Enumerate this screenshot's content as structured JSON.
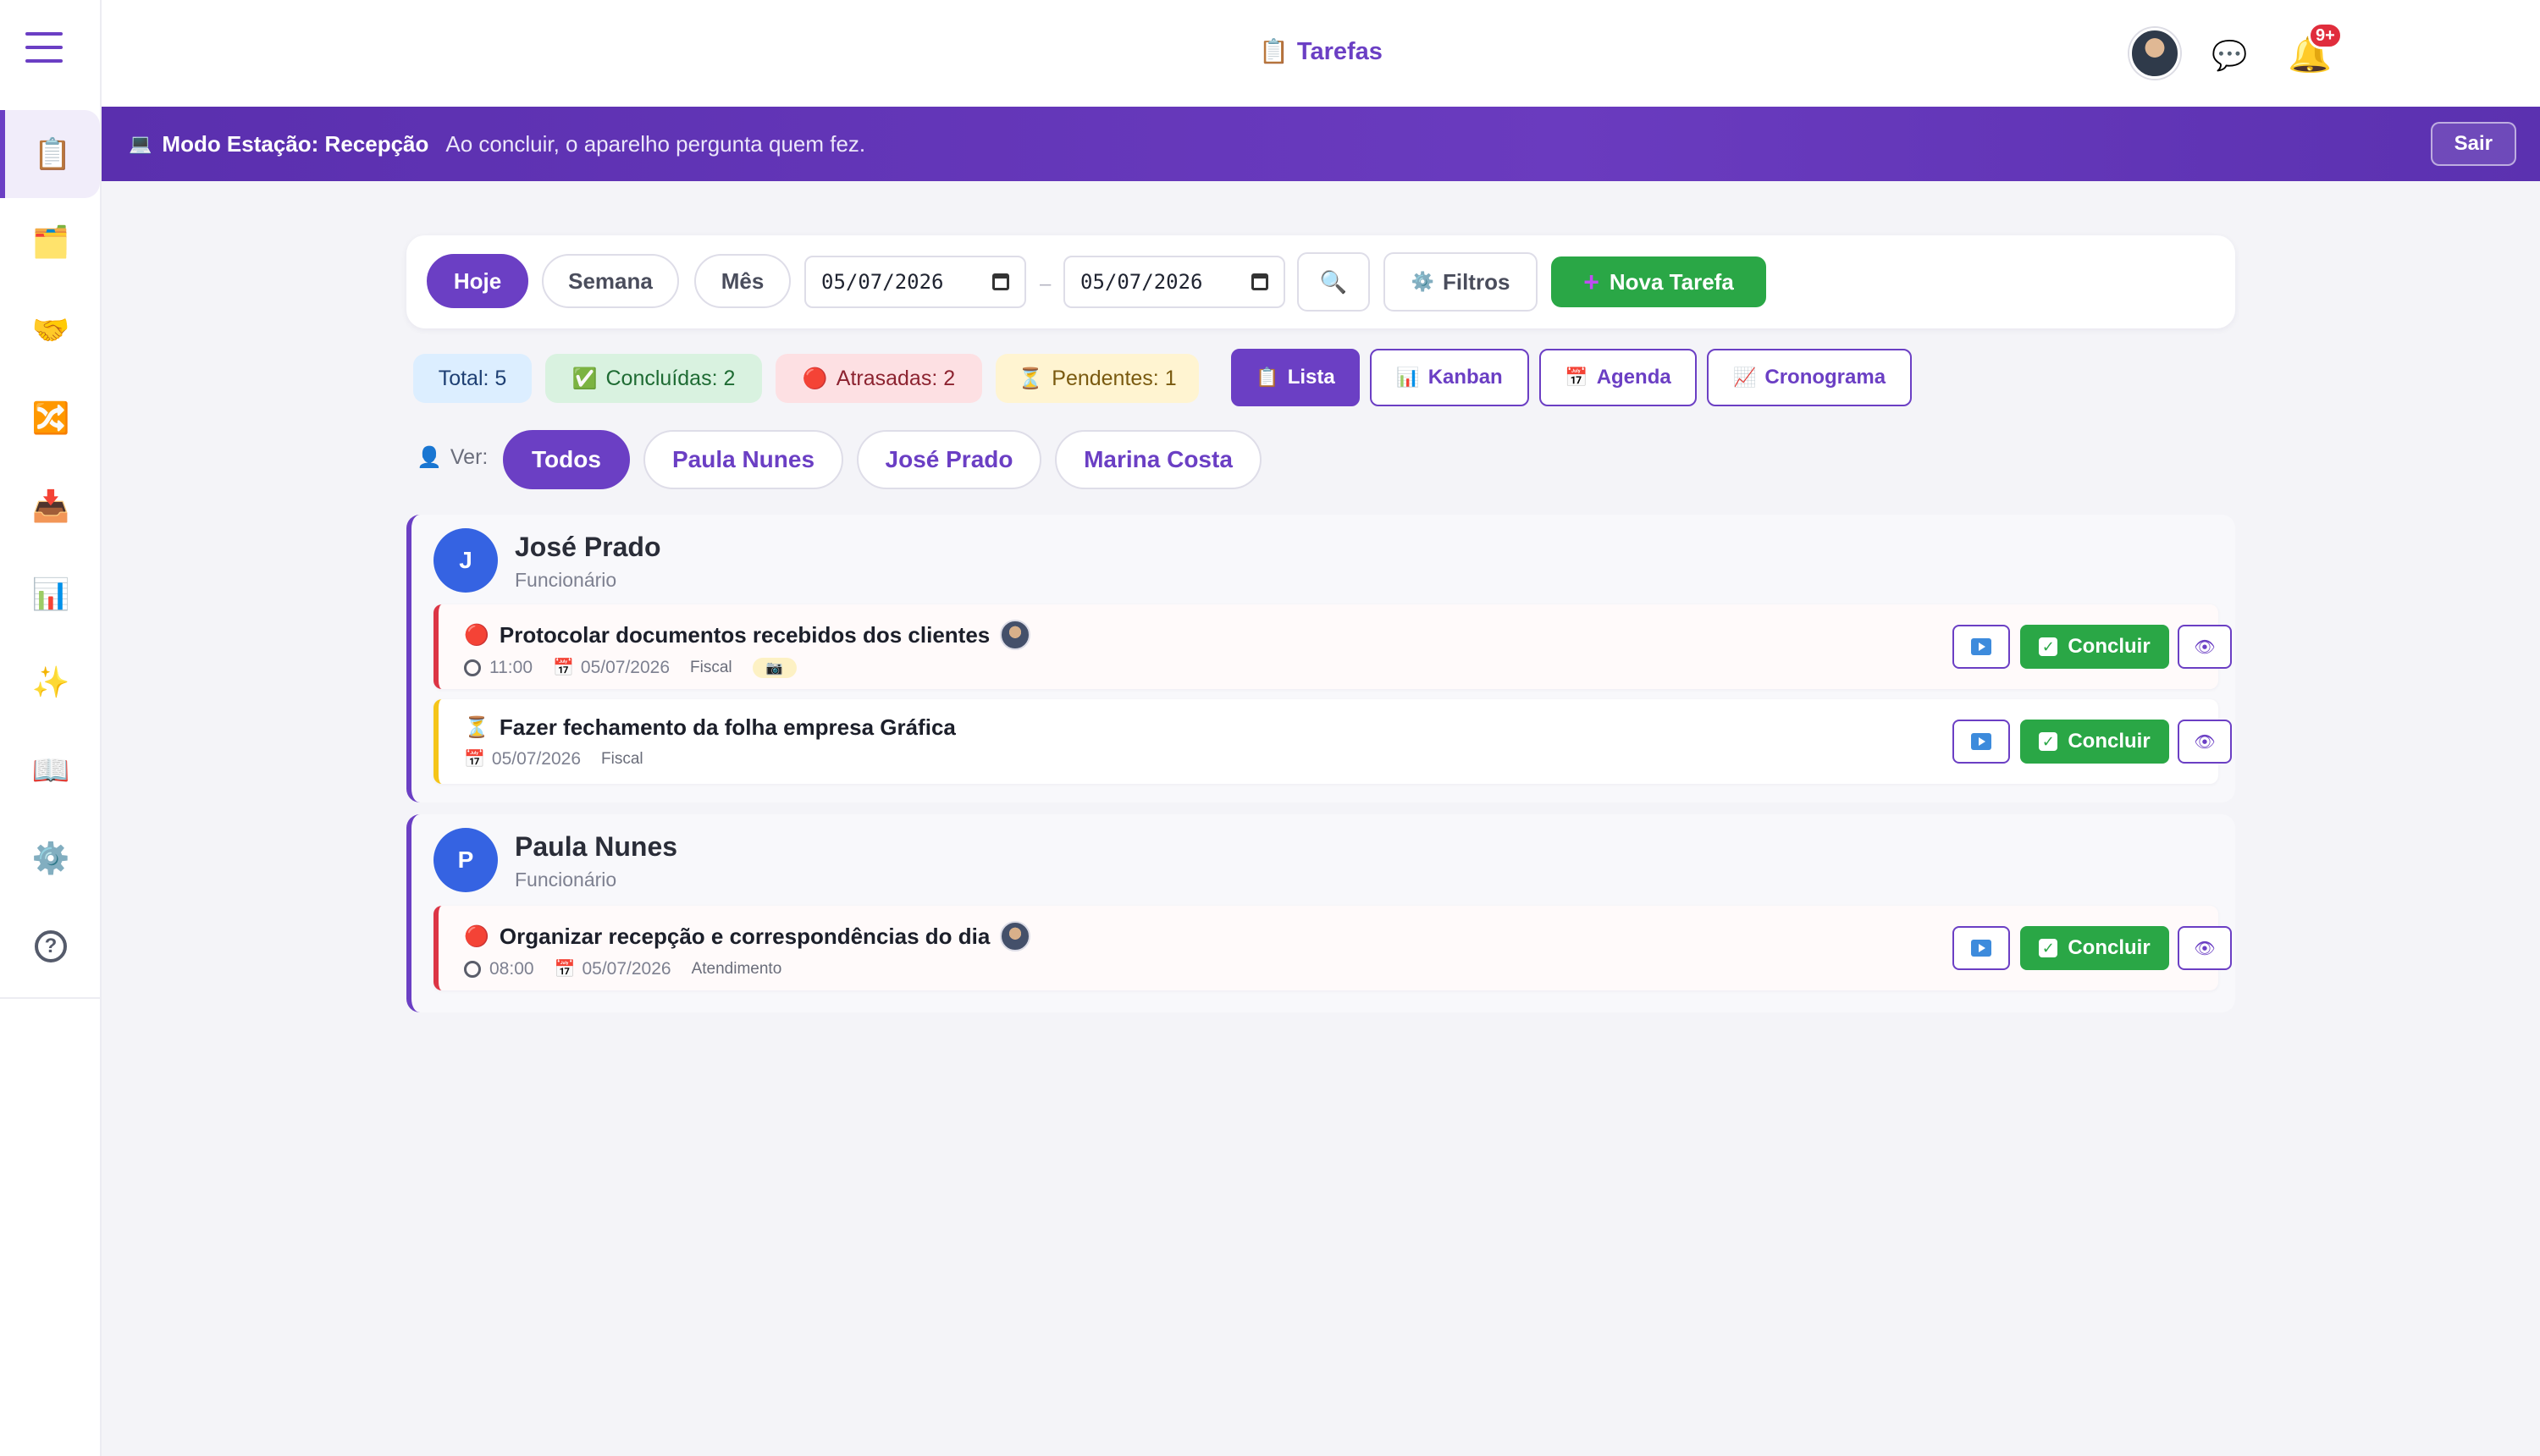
{
  "header": {
    "title": "Tarefas",
    "title_icon": "clipboard-icon",
    "notification_count": "9+"
  },
  "sidebar": {
    "items": [
      {
        "icon": "clipboard-icon",
        "glyph": "📋",
        "active": true
      },
      {
        "icon": "folder-icon",
        "glyph": "🗂️"
      },
      {
        "icon": "handshake-icon",
        "glyph": "🤝"
      },
      {
        "icon": "shuffle-icon",
        "glyph": "🔀"
      },
      {
        "icon": "inbox-tray-icon",
        "glyph": "📥"
      },
      {
        "icon": "bar-chart-icon",
        "glyph": "📊"
      },
      {
        "icon": "sparkles-icon",
        "glyph": "✨"
      },
      {
        "icon": "book-icon",
        "glyph": "📖"
      },
      {
        "icon": "gear-icon",
        "glyph": "⚙️"
      }
    ],
    "help_glyph": "?"
  },
  "station": {
    "label": "Modo Estação: Recepção",
    "message": "Ao concluir, o aparelho pergunta quem fez.",
    "exit_label": "Sair"
  },
  "toolbar": {
    "periods": [
      "Hoje",
      "Semana",
      "Mês"
    ],
    "active_period": "Hoje",
    "date_from": "05/07/2026",
    "date_to": "05/07/2026",
    "filters_label": "Filtros",
    "new_task_label": "Nova Tarefa"
  },
  "stats": {
    "total": "Total: 5",
    "done": "Concluídas: 2",
    "late": "Atrasadas: 2",
    "pending": "Pendentes: 1"
  },
  "views": {
    "list": "Lista",
    "kanban": "Kanban",
    "agenda": "Agenda",
    "schedule": "Cronograma",
    "active": "Lista"
  },
  "people_filter": {
    "label": "Ver:",
    "options": [
      "Todos",
      "Paula Nunes",
      "José Prado",
      "Marina Costa"
    ],
    "active": "Todos"
  },
  "groups": [
    {
      "initial": "J",
      "name": "José Prado",
      "role": "Funcionário",
      "tasks": [
        {
          "status": "overdue",
          "title": "Protocolar documentos recebidos dos clientes",
          "time": "11:00",
          "date": "05/07/2026",
          "category": "Fiscal",
          "chip": "📷"
        },
        {
          "status": "pending",
          "title": "Fazer fechamento da folha empresa Gráfica",
          "date": "05/07/2026",
          "category": "Fiscal"
        }
      ]
    },
    {
      "initial": "P",
      "name": "Paula Nunes",
      "role": "Funcionário",
      "tasks": [
        {
          "status": "overdue",
          "title": "Organizar recepção e correspondências do dia",
          "time": "08:00",
          "date": "05/07/2026",
          "category": "Atendimento"
        }
      ]
    }
  ],
  "task_actions": {
    "complete_label": "Concluir"
  },
  "colors": {
    "brand": "#6b3fc4",
    "success": "#2aa746",
    "danger": "#dc3545",
    "warning": "#f5c518",
    "avatar": "#3563e2"
  }
}
